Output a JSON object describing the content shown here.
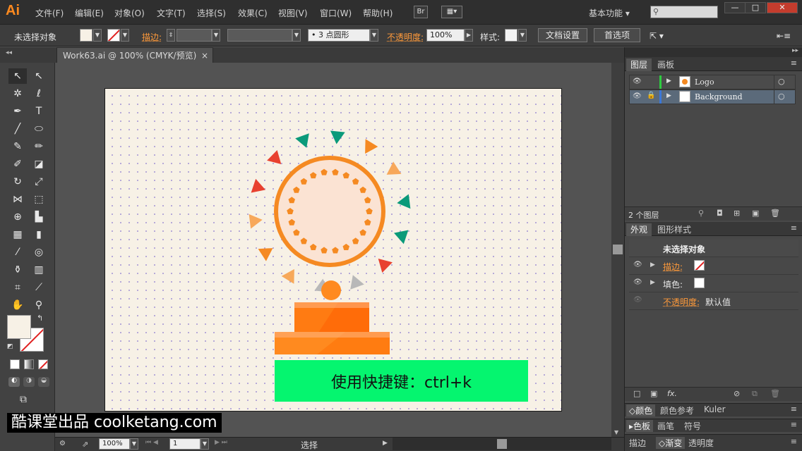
{
  "app": {
    "logo": "Ai"
  },
  "menu": [
    "文件(F)",
    "编辑(E)",
    "对象(O)",
    "文字(T)",
    "选择(S)",
    "效果(C)",
    "视图(V)",
    "窗口(W)",
    "帮助(H)"
  ],
  "menubar_buttons": {
    "bridge": "Br"
  },
  "workspace": "基本功能",
  "control_bar": {
    "selection": "未选择对象",
    "stroke_label": "描边:",
    "brush": "3 点圆形",
    "opacity_label": "不透明度:",
    "opacity_value": "100%",
    "style_label": "样式:",
    "doc_setup": "文档设置",
    "preferences": "首选项"
  },
  "document_tab": {
    "title": "Work63.ai @ 100% (CMYK/预览)",
    "close": "×"
  },
  "artwork": {
    "caption": "使用快捷键：ctrl+k"
  },
  "colors": {
    "orange": "#ff8a1f",
    "green_banner": "#05f56f",
    "teal": "#0a9a7a",
    "red": "#e8412f"
  },
  "layers_panel": {
    "tabs": [
      "图层",
      "画板"
    ],
    "layers": [
      {
        "name": "Logo"
      },
      {
        "name": "Background"
      }
    ],
    "count": "2 个图层"
  },
  "appearance_panel": {
    "tabs": [
      "外观",
      "图形样式"
    ],
    "title": "未选择对象",
    "rows": [
      {
        "label": "描边:",
        "link": true
      },
      {
        "label": "填色:",
        "link": false
      },
      {
        "label": "不透明度:",
        "value": "默认值",
        "link": true
      }
    ],
    "fx": "fx."
  },
  "collapsed_panels": [
    [
      "颜色",
      "颜色参考",
      "Kuler"
    ],
    [
      "色板",
      "画笔",
      "符号"
    ],
    [
      "描边",
      "渐变",
      "透明度"
    ]
  ],
  "status_bar": {
    "zoom": "100%",
    "page": "1",
    "tool": "选择"
  },
  "watermark": "酷课堂出品 coolketang.com"
}
